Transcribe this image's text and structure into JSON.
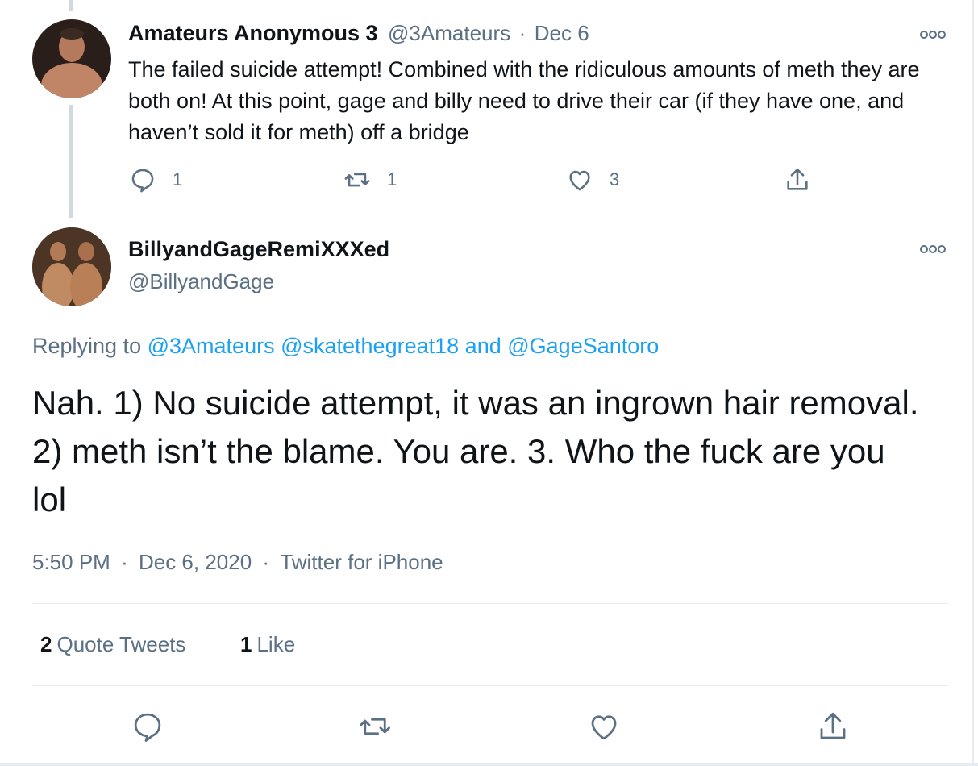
{
  "tweet_parent": {
    "display_name": "Amateurs Anonymous 3",
    "handle": "@3Amateurs",
    "separator": "·",
    "date": "Dec 6",
    "text": "The failed suicide attempt! Combined with the ridiculous amounts of meth they are both on! At this point, gage and billy need to drive their car (if they have one, and haven’t sold it for meth) off a bridge",
    "reply_count": "1",
    "retweet_count": "1",
    "like_count": "3",
    "more_icon": "more-options-icon"
  },
  "tweet_main": {
    "display_name": "BillyandGageRemiXXXed",
    "handle": "@BillyandGage",
    "replying_prefix": "Replying to",
    "mention_1": "@3Amateurs",
    "mention_2": "@skatethegreat18",
    "and_word": "and",
    "mention_3": "@GageSantoro",
    "text": "Nah. 1) No suicide attempt, it was an ingrown hair removal. 2) meth isn’t the blame. You are. 3. Who the fuck are you lol",
    "time": "5:50 PM",
    "separator": "·",
    "date": "Dec 6, 2020",
    "source": "Twitter for iPhone",
    "quote_tweets_count": "2",
    "quote_tweets_label": "Quote Tweets",
    "likes_count": "1",
    "likes_label": "Like"
  },
  "colors": {
    "text": "#0f1419",
    "muted": "#5b7083",
    "link": "#1da1f2",
    "divider": "#e6ecf0"
  }
}
